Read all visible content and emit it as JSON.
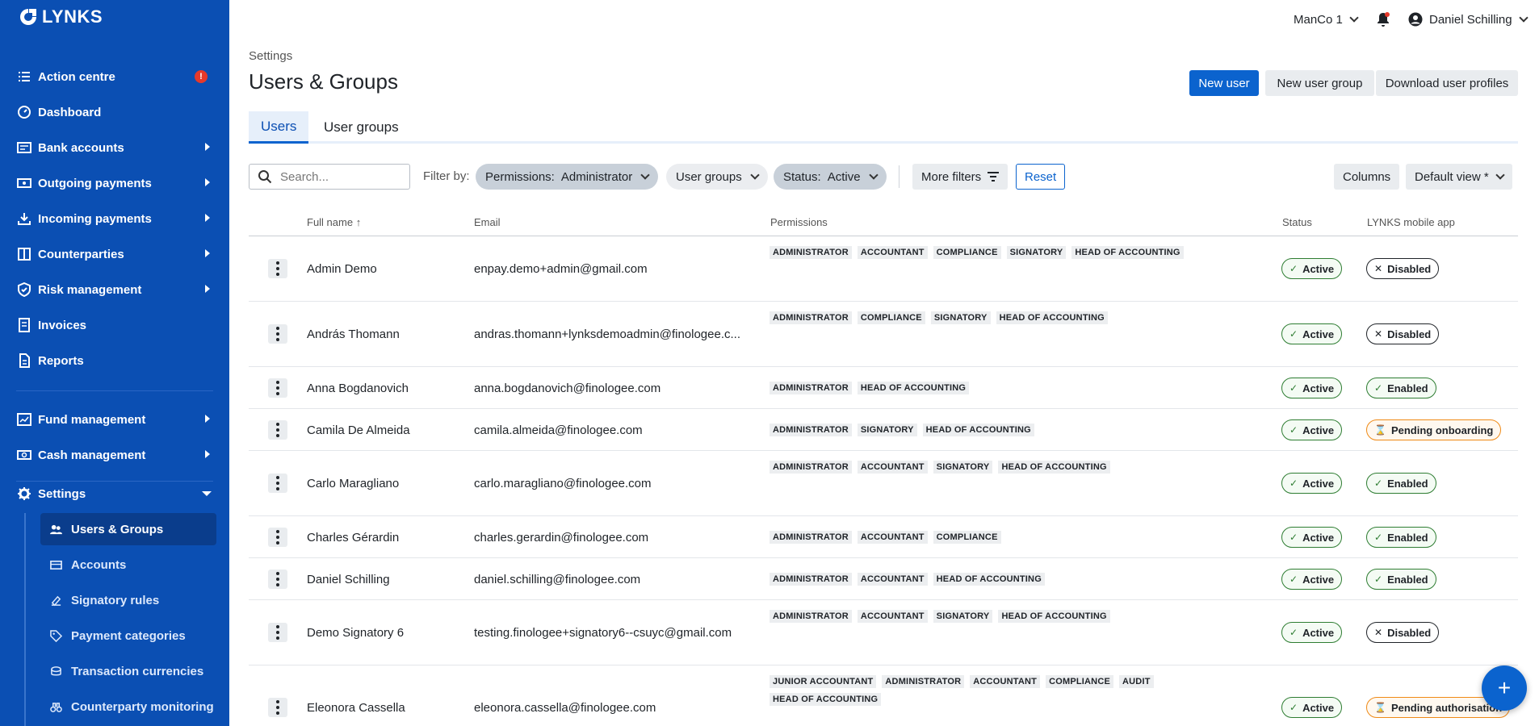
{
  "brand": {
    "name": "LYNKS"
  },
  "sidebar": {
    "items": [
      {
        "label": "Action centre",
        "badge": "!"
      },
      {
        "label": "Dashboard"
      },
      {
        "label": "Bank accounts"
      },
      {
        "label": "Outgoing payments"
      },
      {
        "label": "Incoming payments"
      },
      {
        "label": "Counterparties"
      },
      {
        "label": "Risk management"
      },
      {
        "label": "Invoices"
      },
      {
        "label": "Reports"
      },
      {
        "label": "Fund management"
      },
      {
        "label": "Cash management"
      },
      {
        "label": "Settings"
      }
    ],
    "settings_items": [
      {
        "label": "Users & Groups"
      },
      {
        "label": "Accounts"
      },
      {
        "label": "Signatory rules"
      },
      {
        "label": "Payment categories"
      },
      {
        "label": "Transaction currencies"
      },
      {
        "label": "Counterparty monitoring"
      }
    ]
  },
  "topbar": {
    "company": "ManCo 1",
    "user": "Daniel Schilling"
  },
  "breadcrumb": "Settings",
  "title": "Users & Groups",
  "actions": {
    "new_user": "New user",
    "new_group": "New user group",
    "download": "Download user profiles"
  },
  "tabs": [
    "Users",
    "User groups"
  ],
  "filters": {
    "search_placeholder": "Search...",
    "filter_by": "Filter by:",
    "permissions_key": "Permissions:",
    "permissions_value": "Administrator",
    "user_groups": "User groups",
    "status_key": "Status:",
    "status_value": "Active",
    "more_filters": "More filters",
    "reset": "Reset",
    "columns": "Columns",
    "view": "Default view *"
  },
  "table": {
    "headers": [
      "Full name",
      "Email",
      "Permissions",
      "Status",
      "LYNKS mobile app"
    ],
    "rows": [
      {
        "name": "Admin Demo",
        "email": "enpay.demo+admin@gmail.com",
        "perms": [
          "ADMINISTRATOR",
          "ACCOUNTANT",
          "COMPLIANCE",
          "SIGNATORY",
          "HEAD OF ACCOUNTING"
        ],
        "status": "Active",
        "app": "Disabled"
      },
      {
        "name": "András Thomann",
        "email": "andras.thomann+lynksdemoadmin@finologee.c...",
        "perms": [
          "ADMINISTRATOR",
          "COMPLIANCE",
          "SIGNATORY",
          "HEAD OF ACCOUNTING"
        ],
        "status": "Active",
        "app": "Disabled"
      },
      {
        "name": "Anna Bogdanovich",
        "email": "anna.bogdanovich@finologee.com",
        "perms": [
          "ADMINISTRATOR",
          "HEAD OF ACCOUNTING"
        ],
        "status": "Active",
        "app": "Enabled"
      },
      {
        "name": "Camila De Almeida",
        "email": "camila.almeida@finologee.com",
        "perms": [
          "ADMINISTRATOR",
          "SIGNATORY",
          "HEAD OF ACCOUNTING"
        ],
        "status": "Active",
        "app": "Pending onboarding"
      },
      {
        "name": "Carlo Maragliano",
        "email": "carlo.maragliano@finologee.com",
        "perms": [
          "ADMINISTRATOR",
          "ACCOUNTANT",
          "SIGNATORY",
          "HEAD OF ACCOUNTING"
        ],
        "status": "Active",
        "app": "Enabled"
      },
      {
        "name": "Charles Gérardin",
        "email": "charles.gerardin@finologee.com",
        "perms": [
          "ADMINISTRATOR",
          "ACCOUNTANT",
          "COMPLIANCE"
        ],
        "status": "Active",
        "app": "Enabled"
      },
      {
        "name": "Daniel Schilling",
        "email": "daniel.schilling@finologee.com",
        "perms": [
          "ADMINISTRATOR",
          "ACCOUNTANT",
          "HEAD OF ACCOUNTING"
        ],
        "status": "Active",
        "app": "Enabled"
      },
      {
        "name": "Demo Signatory 6",
        "email": "testing.finologee+signatory6--csuyc@gmail.com",
        "perms": [
          "ADMINISTRATOR",
          "ACCOUNTANT",
          "SIGNATORY",
          "HEAD OF ACCOUNTING"
        ],
        "status": "Active",
        "app": "Disabled"
      },
      {
        "name": "Eleonora Cassella",
        "email": "eleonora.cassella@finologee.com",
        "perms": [
          "JUNIOR ACCOUNTANT",
          "ADMINISTRATOR",
          "ACCOUNTANT",
          "COMPLIANCE",
          "AUDIT",
          "HEAD OF ACCOUNTING"
        ],
        "status": "Active",
        "app": "Pending authorisation"
      }
    ]
  },
  "colors": {
    "sidebar": "#0b4fb3",
    "primary": "#0b63ce",
    "success": "#2e7d32",
    "warning": "#ef8a17",
    "alert": "#e5392b"
  }
}
